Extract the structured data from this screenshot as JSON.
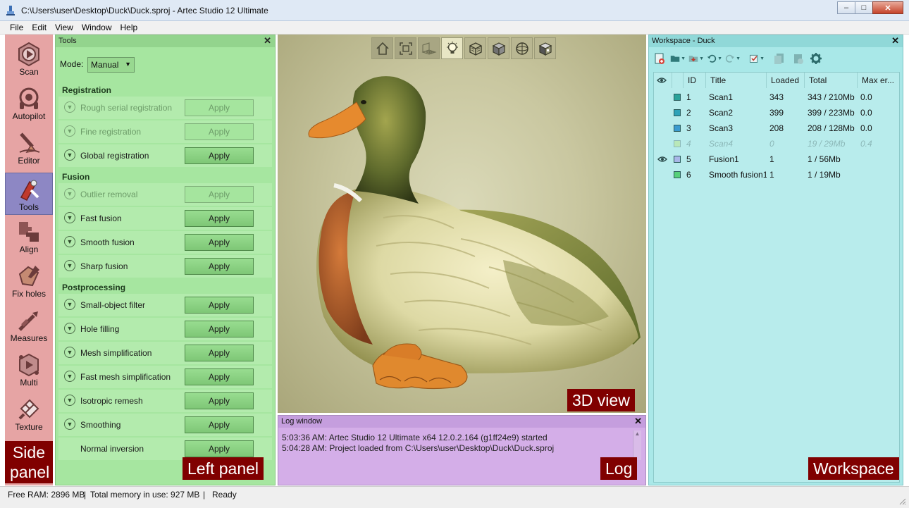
{
  "window": {
    "title": "C:\\Users\\user\\Desktop\\Duck\\Duck.sproj - Artec Studio 12 Ultimate",
    "minimize": "–",
    "maximize": "□",
    "close": "✕"
  },
  "menu": [
    "File",
    "Edit",
    "View",
    "Window",
    "Help"
  ],
  "side_panel": {
    "items": [
      {
        "label": "Scan",
        "icon": "scan-icon"
      },
      {
        "label": "Autopilot",
        "icon": "autopilot-icon"
      },
      {
        "label": "Editor",
        "icon": "editor-icon"
      },
      {
        "label": "Tools",
        "icon": "tools-icon",
        "active": true
      },
      {
        "label": "Align",
        "icon": "align-icon"
      },
      {
        "label": "Fix holes",
        "icon": "fix-holes-icon"
      },
      {
        "label": "Measures",
        "icon": "measures-icon"
      },
      {
        "label": "Multi",
        "icon": "multi-icon"
      },
      {
        "label": "Texture",
        "icon": "texture-icon"
      }
    ],
    "caption_line1": "Side",
    "caption_line2": "panel"
  },
  "tools_panel": {
    "header": "Tools",
    "close": "✕",
    "mode_label": "Mode:",
    "mode_value": "Manual",
    "caption": "Left panel",
    "sections": {
      "registration": "Registration",
      "fusion": "Fusion",
      "postprocessing": "Postprocessing"
    },
    "rows": [
      {
        "name": "Rough serial registration",
        "button": "Apply",
        "enabled": false
      },
      {
        "name": "Fine registration",
        "button": "Apply",
        "enabled": false
      },
      {
        "name": "Global registration",
        "button": "Apply",
        "enabled": true
      },
      {
        "name": "Outlier removal",
        "button": "Apply",
        "enabled": false
      },
      {
        "name": "Fast fusion",
        "button": "Apply",
        "enabled": true
      },
      {
        "name": "Smooth fusion",
        "button": "Apply",
        "enabled": true
      },
      {
        "name": "Sharp fusion",
        "button": "Apply",
        "enabled": true
      },
      {
        "name": "Small-object filter",
        "button": "Apply",
        "enabled": true
      },
      {
        "name": "Hole filling",
        "button": "Apply",
        "enabled": true
      },
      {
        "name": "Mesh simplification",
        "button": "Apply",
        "enabled": true
      },
      {
        "name": "Fast mesh simplification",
        "button": "Apply",
        "enabled": true
      },
      {
        "name": "Isotropic remesh",
        "button": "Apply",
        "enabled": true
      },
      {
        "name": "Smoothing",
        "button": "Apply",
        "enabled": true
      },
      {
        "name": "Normal inversion",
        "button": "Apply",
        "enabled": true
      }
    ]
  },
  "view3d": {
    "caption": "3D view",
    "toolbar": [
      "home-icon",
      "fit-view-icon",
      "grid-icon",
      "light-bulb-icon",
      "wireframe-box-icon",
      "solid-box-icon",
      "sphere-icon",
      "textured-box-icon"
    ]
  },
  "log": {
    "header": "Log window",
    "close": "✕",
    "caption": "Log",
    "lines": [
      "5:03:36 AM: Artec Studio 12 Ultimate x64 12.0.2.164 (g1ff24e9) started",
      "5:04:28 AM: Project loaded from C:\\Users\\user\\Desktop\\Duck\\Duck.sproj"
    ]
  },
  "workspace": {
    "header": "Workspace - Duck",
    "close": "✕",
    "caption": "Workspace",
    "columns": [
      "ID",
      "Title",
      "Loaded",
      "Total",
      "Max er..."
    ],
    "rows": [
      {
        "id": "1",
        "title": "Scan1",
        "loaded": "343",
        "total": "343 / 210Mb",
        "max_err": "0.0",
        "color": "#2aa39a"
      },
      {
        "id": "2",
        "title": "Scan2",
        "loaded": "399",
        "total": "399 / 223Mb",
        "max_err": "0.0",
        "color": "#2ea2b8"
      },
      {
        "id": "3",
        "title": "Scan3",
        "loaded": "208",
        "total": "208 / 128Mb",
        "max_err": "0.0",
        "color": "#3a9bd0"
      },
      {
        "id": "4",
        "title": "Scan4",
        "loaded": "0",
        "total": "19 / 29Mb",
        "max_err": "0.4",
        "color": "#b9e8b9"
      },
      {
        "id": "5",
        "title": "Fusion1",
        "loaded": "1",
        "total": "1 / 56Mb",
        "max_err": "",
        "color": "#a9b7e8"
      },
      {
        "id": "6",
        "title": "Smooth fusion1",
        "loaded": "1",
        "total": "1 / 19Mb",
        "max_err": "",
        "color": "#57d07a"
      }
    ]
  },
  "status": {
    "free_ram": "Free RAM: 2896 MB",
    "total_memory": "Total memory in use: 927 MB",
    "state": "Ready",
    "sep": "|"
  }
}
